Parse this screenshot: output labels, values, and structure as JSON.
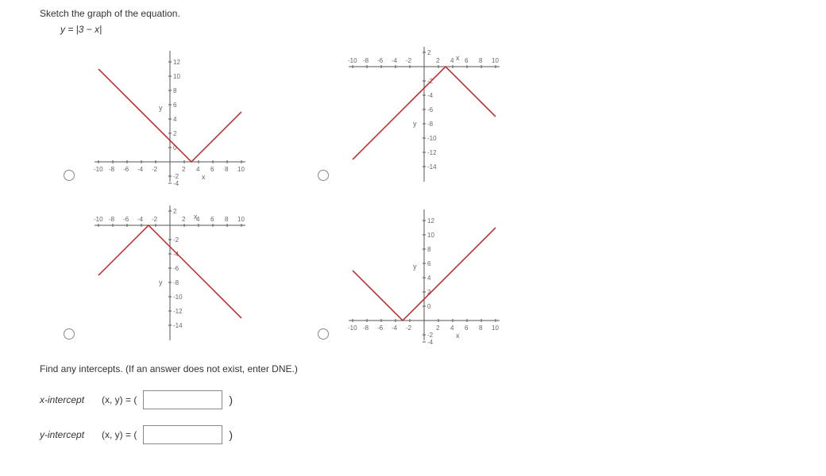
{
  "question": {
    "prompt": "Sketch the graph of the equation.",
    "equation": "y = |3 − x|"
  },
  "chart_data": [
    {
      "type": "line",
      "title": "",
      "xlabel": "x",
      "ylabel": "y",
      "xlim": [
        -10,
        10
      ],
      "ylim": [
        -4,
        14
      ],
      "xticks": [
        -10,
        -8,
        -6,
        -4,
        -2,
        0,
        2,
        4,
        6,
        8,
        10
      ],
      "yticks": [
        -4,
        -2,
        0,
        2,
        4,
        6,
        8,
        10,
        12,
        14
      ],
      "series": [
        {
          "name": "graph",
          "x": [
            -10,
            3,
            10
          ],
          "y": [
            13,
            0,
            7
          ]
        }
      ]
    },
    {
      "type": "line",
      "title": "",
      "xlabel": "x",
      "ylabel": "y",
      "xlim": [
        -10,
        10
      ],
      "ylim": [
        -14,
        4
      ],
      "xticks": [
        -10,
        -8,
        -6,
        -4,
        -2,
        0,
        2,
        4,
        6,
        8,
        10
      ],
      "yticks": [
        -14,
        -12,
        -10,
        -8,
        -6,
        -4,
        -2,
        0,
        2,
        4
      ],
      "series": [
        {
          "name": "graph",
          "x": [
            -10,
            3,
            10
          ],
          "y": [
            -13,
            0,
            -7
          ]
        }
      ]
    },
    {
      "type": "line",
      "title": "",
      "xlabel": "x",
      "ylabel": "y",
      "xlim": [
        -10,
        10
      ],
      "ylim": [
        -14,
        4
      ],
      "xticks": [
        -10,
        -8,
        -6,
        -4,
        -2,
        0,
        2,
        4,
        6,
        8,
        10
      ],
      "yticks": [
        -14,
        -12,
        -10,
        -8,
        -6,
        -4,
        -2,
        0,
        2,
        4
      ],
      "series": [
        {
          "name": "graph",
          "x": [
            -10,
            -3,
            10
          ],
          "y": [
            -7,
            0,
            -13
          ]
        }
      ]
    },
    {
      "type": "line",
      "title": "",
      "xlabel": "x",
      "ylabel": "y",
      "xlim": [
        -10,
        10
      ],
      "ylim": [
        -4,
        14
      ],
      "xticks": [
        -10,
        -8,
        -6,
        -4,
        -2,
        0,
        2,
        4,
        6,
        8,
        10
      ],
      "yticks": [
        -4,
        -2,
        0,
        2,
        4,
        6,
        8,
        10,
        12,
        14
      ],
      "series": [
        {
          "name": "graph",
          "x": [
            -10,
            -3,
            10
          ],
          "y": [
            7,
            0,
            13
          ]
        }
      ]
    }
  ],
  "intercepts": {
    "prompt": "Find any intercepts. (If an answer does not exist, enter DNE.)",
    "rows": [
      {
        "label": "x-intercept",
        "prefix": "(x, y) = (",
        "value": "",
        "suffix": ")"
      },
      {
        "label": "y-intercept",
        "prefix": "(x, y) = (",
        "value": "",
        "suffix": ")"
      }
    ]
  },
  "parens": {
    "close": ")"
  }
}
